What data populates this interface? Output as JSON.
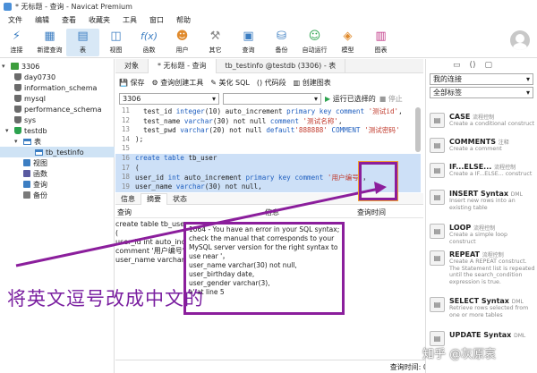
{
  "window": {
    "title": "* 无标题 - 查询 - Navicat Premium"
  },
  "menu": [
    "文件",
    "编辑",
    "查看",
    "收藏夹",
    "工具",
    "窗口",
    "帮助"
  ],
  "toolbar": [
    {
      "label": "连接",
      "icon": "plug-icon"
    },
    {
      "label": "新建查询",
      "icon": "new-query-icon"
    },
    {
      "label": "表",
      "icon": "table-icon",
      "active": true
    },
    {
      "label": "视图",
      "icon": "view-icon"
    },
    {
      "label": "函数",
      "icon": "function-icon",
      "glyph": "f(x)"
    },
    {
      "label": "用户",
      "icon": "user-icon"
    },
    {
      "label": "其它",
      "icon": "tools-icon"
    },
    {
      "label": "查询",
      "icon": "query-icon"
    },
    {
      "label": "备份",
      "icon": "backup-icon"
    },
    {
      "label": "自动运行",
      "icon": "robot-icon"
    },
    {
      "label": "模型",
      "icon": "model-icon"
    },
    {
      "label": "图表",
      "icon": "chart-icon"
    }
  ],
  "sidebar": {
    "items": [
      {
        "label": "3306",
        "icon": "connection-icon",
        "expanded": true
      },
      {
        "label": "day0730",
        "icon": "database-icon"
      },
      {
        "label": "information_schema",
        "icon": "database-icon"
      },
      {
        "label": "mysql",
        "icon": "database-icon"
      },
      {
        "label": "performance_schema",
        "icon": "database-icon"
      },
      {
        "label": "sys",
        "icon": "database-icon"
      },
      {
        "label": "testdb",
        "icon": "database-icon",
        "expanded": true
      },
      {
        "label": "表",
        "icon": "tables-icon",
        "expanded": true
      },
      {
        "label": "tb_testinfo",
        "icon": "table-icon",
        "selected": true
      },
      {
        "label": "视图",
        "icon": "views-icon"
      },
      {
        "label": "函数",
        "icon": "functions-icon"
      },
      {
        "label": "查询",
        "icon": "queries-icon"
      },
      {
        "label": "备份",
        "icon": "backups-icon"
      }
    ]
  },
  "tabs": [
    "对象",
    "* 无标题 - 查询",
    "tb_testinfo @testdb (3306) - 表"
  ],
  "query_toolbar": [
    "保存",
    "查询创建工具",
    "美化 SQL",
    "代码段",
    "创建图表"
  ],
  "query_bar": {
    "connection": "3306",
    "database": "",
    "run": "运行已选择的",
    "stop": "停止"
  },
  "editor": {
    "lines": [
      {
        "n": "11",
        "parts": [
          [
            "",
            "  test_id "
          ],
          [
            "kw",
            "integer"
          ],
          [
            "",
            "(10) auto_increment "
          ],
          [
            "kw",
            "primary key comment "
          ],
          [
            "str",
            "'测试id'"
          ],
          [
            "",
            ","
          ]
        ]
      },
      {
        "n": "12",
        "parts": [
          [
            "",
            "  test_name "
          ],
          [
            "kw",
            "varchar"
          ],
          [
            "",
            "(30) not null "
          ],
          [
            "kw",
            "comment "
          ],
          [
            "str",
            "'测试名称'"
          ],
          [
            "",
            ","
          ]
        ]
      },
      {
        "n": "13",
        "parts": [
          [
            "",
            "  test_pwd "
          ],
          [
            "kw",
            "varchar"
          ],
          [
            "",
            "(20) not null "
          ],
          [
            "kw",
            "default"
          ],
          [
            "str",
            "'888888'"
          ],
          [
            "kw",
            " COMMENT "
          ],
          [
            "str",
            "'测试密码'"
          ]
        ]
      },
      {
        "n": "14",
        "parts": [
          [
            "",
            ");"
          ]
        ]
      },
      {
        "n": "15",
        "parts": [
          [
            "",
            ""
          ]
        ]
      },
      {
        "n": "16",
        "hl": true,
        "parts": [
          [
            "kw",
            "create table "
          ],
          [
            "",
            "tb_user"
          ]
        ]
      },
      {
        "n": "17",
        "hl": true,
        "parts": [
          [
            "",
            "("
          ]
        ]
      },
      {
        "n": "18",
        "hl": true,
        "parts": [
          [
            "",
            "user_id "
          ],
          [
            "kw",
            "int "
          ],
          [
            "",
            "auto_increment "
          ],
          [
            "kw",
            "primary key comment "
          ],
          [
            "str",
            "'用户编号'"
          ],
          [
            "",
            "，"
          ]
        ]
      },
      {
        "n": "19",
        "hl": true,
        "parts": [
          [
            "",
            "user_name "
          ],
          [
            "kw",
            "varchar"
          ],
          [
            "",
            "(30) not null,"
          ]
        ]
      }
    ]
  },
  "bottom_tabs": [
    "信息",
    "摘要",
    "状态"
  ],
  "result": {
    "headers": [
      "查询",
      "信息",
      "查询时间"
    ],
    "query_lines": [
      "create table tb_user",
      "(",
      "user_id int auto_incr",
      "comment '用户编号'",
      "user_name varchar(3"
    ],
    "error_lines": [
      "1064 - You have an error in your SQL syntax;",
      "check the manual that corresponds to your",
      "MySQL server version for the right syntax to",
      "use near '，",
      "user_name varchar(30) not null,",
      "user_birthday date,",
      "user_gender varchar(3),",
      "a' at line 5"
    ]
  },
  "status": {
    "time": "查询时间: 0.011s"
  },
  "right_panel": {
    "connection_select": "我的连接",
    "filter_select": "全部标签",
    "snippets": [
      {
        "title": "CASE",
        "tag": "流程控制",
        "desc": "Create a conditional construct"
      },
      {
        "title": "COMMENTS",
        "tag": "注释",
        "desc": "Create a comment"
      },
      {
        "title": "IF...ELSE...",
        "tag": "流程控制",
        "desc": "Create a IF...ELSE... construct"
      },
      {
        "title": "INSERT Syntax",
        "tag": "DML",
        "desc": "Insert new rows into an existing table"
      },
      {
        "title": "LOOP",
        "tag": "流程控制",
        "desc": "Create a simple loop construct"
      },
      {
        "title": "REPEAT",
        "tag": "流程控制",
        "desc": "Create A REPEAT construct. The Statement list is repeated until the search_condition expression is true."
      },
      {
        "title": "SELECT Syntax",
        "tag": "DML",
        "desc": "Retrieve rows selected from one or more tables"
      },
      {
        "title": "UPDATE Syntax",
        "tag": "DML",
        "desc": ""
      }
    ]
  },
  "annotation": {
    "text": "将英文逗号改成中文的",
    "color": "#8b1e9c"
  },
  "watermark": "知乎 @灰原哀"
}
